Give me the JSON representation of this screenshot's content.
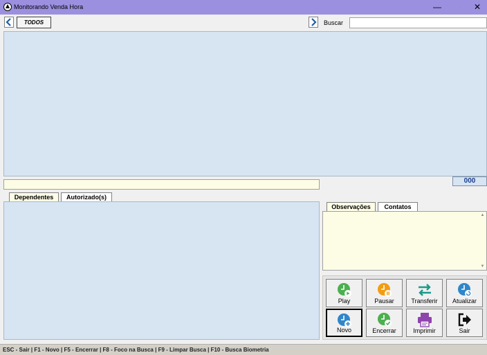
{
  "window": {
    "title": "Monitorando Venda Hora",
    "minimize_glyph": "—",
    "maximize_glyph": "☐",
    "close_glyph": "✕"
  },
  "toolbar": {
    "prev_icon": "chevron-left-icon",
    "next_icon": "chevron-right-icon",
    "filter_label": "TODOS",
    "search_label": "Buscar",
    "search_value": ""
  },
  "counter": {
    "value": "000"
  },
  "left_tabs": [
    {
      "label": "Dependentes",
      "active": true
    },
    {
      "label": "Autorizado(s)",
      "active": false
    }
  ],
  "right_tabs": [
    {
      "label": "Observações",
      "active": true
    },
    {
      "label": "Contatos",
      "active": false
    }
  ],
  "actions": [
    {
      "label": "Play",
      "icon": "clock-play-icon",
      "color": "#4caf50"
    },
    {
      "label": "Pausar",
      "icon": "clock-pause-icon",
      "color": "#f39c12"
    },
    {
      "label": "Transferir",
      "icon": "transfer-icon",
      "color": "#1a9a8a"
    },
    {
      "label": "Atualizar",
      "icon": "clock-refresh-icon",
      "color": "#2f86c9"
    },
    {
      "label": "Novo",
      "icon": "clock-add-icon",
      "color": "#2f86c9"
    },
    {
      "label": "Encerrar",
      "icon": "clock-check-icon",
      "color": "#4caf50"
    },
    {
      "label": "Imprimir",
      "icon": "printer-icon",
      "color": "#8e44ad"
    },
    {
      "label": "Sair",
      "icon": "exit-icon",
      "color": "#111111"
    }
  ],
  "statusbar": {
    "shortcuts": "ESC - Sair  |  F1 - Novo  |  F5 - Encerrar  |  F8 - Foco na Busca  |  F9 - Limpar Busca  |  F10 - Busca Biometria"
  },
  "colors": {
    "titlebar": "#9b8fe0",
    "grid_bg": "#d7e4f1",
    "field_bg": "#fdfde6",
    "counter_text": "#1a3d8f"
  }
}
